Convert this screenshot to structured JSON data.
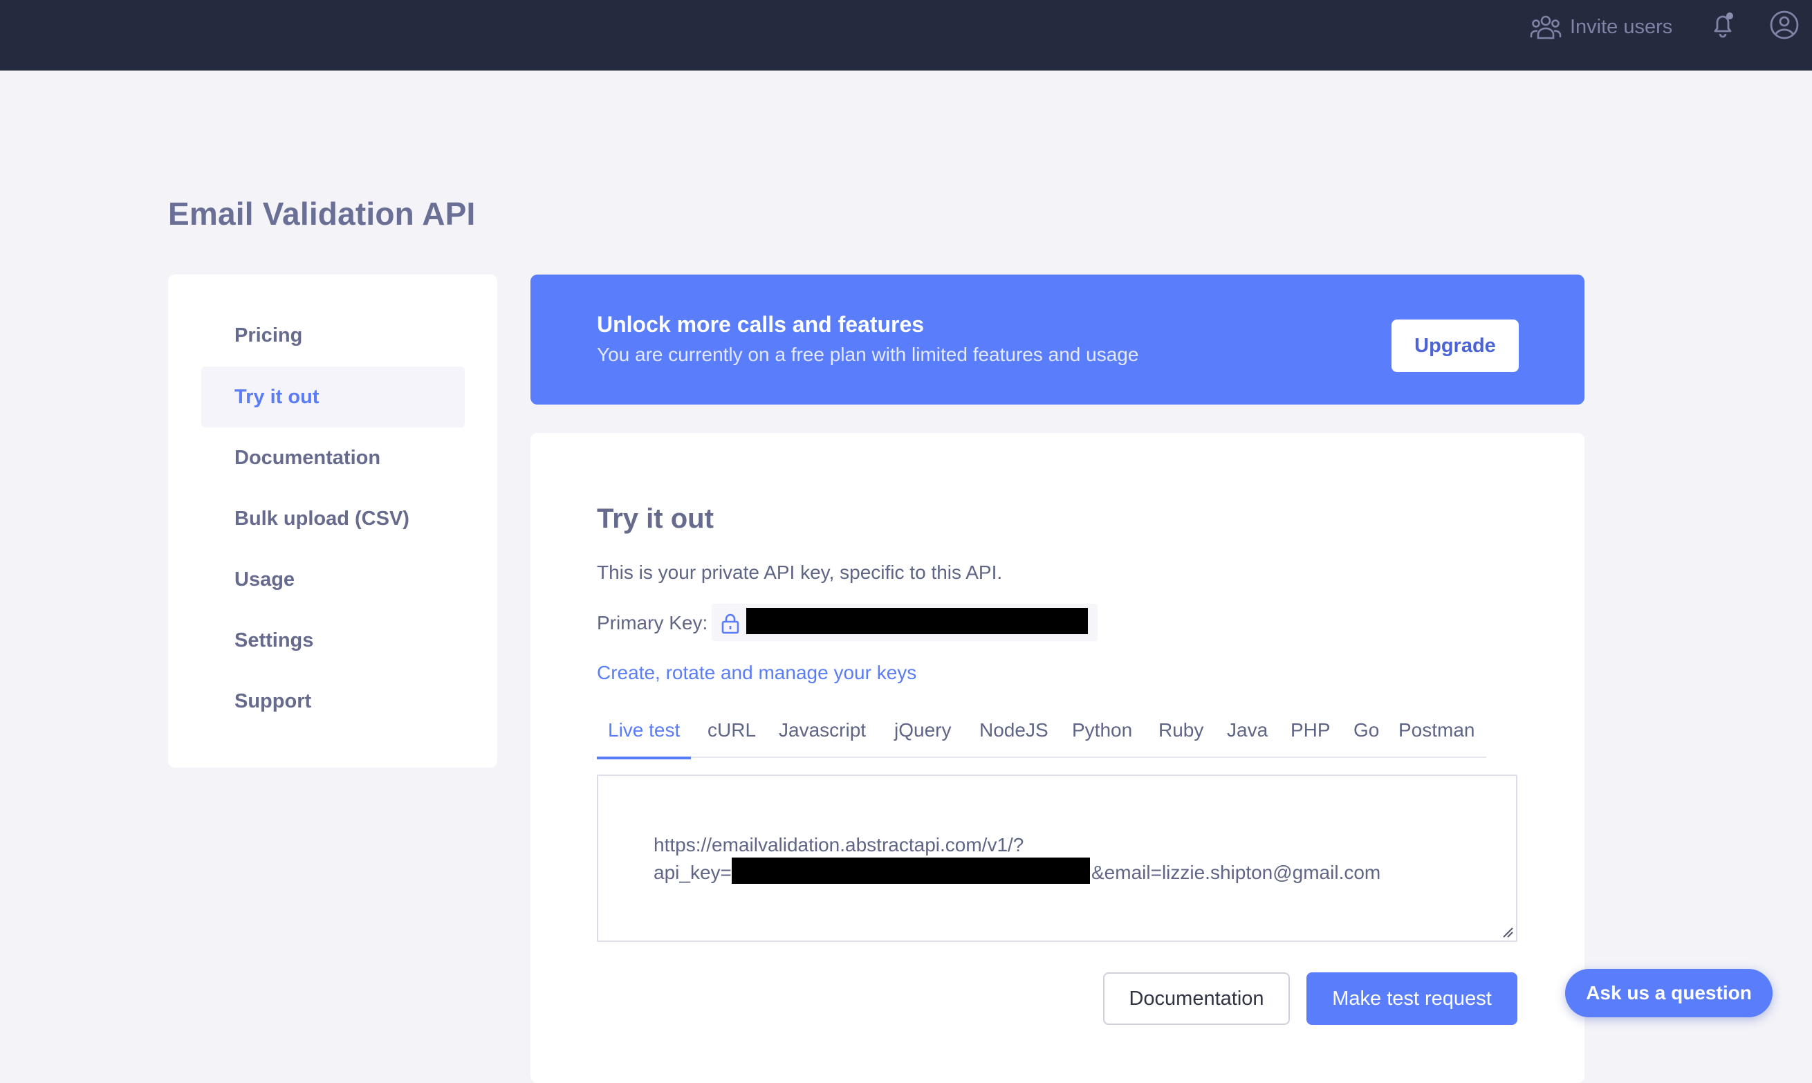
{
  "topbar": {
    "invite_label": "Invite users",
    "icons": [
      "users-icon",
      "bell-icon",
      "user-circle-icon"
    ]
  },
  "page_title": "Email Validation API",
  "sidebar": {
    "items": [
      {
        "label": "Pricing",
        "active": false
      },
      {
        "label": "Try it out",
        "active": true
      },
      {
        "label": "Documentation",
        "active": false
      },
      {
        "label": "Bulk upload (CSV)",
        "active": false
      },
      {
        "label": "Usage",
        "active": false
      },
      {
        "label": "Settings",
        "active": false
      },
      {
        "label": "Support",
        "active": false
      }
    ]
  },
  "banner": {
    "title": "Unlock more calls and features",
    "subtitle": "You are currently on a free plan with limited features and usage",
    "upgrade_label": "Upgrade"
  },
  "card": {
    "title": "Try it out",
    "description": "This is your private API key, specific to this API.",
    "primary_key_label": "Primary Key:",
    "keys_link": "Create, rotate and manage your keys",
    "tabs": [
      "Live test",
      "cURL",
      "Javascript",
      "jQuery",
      "NodeJS",
      "Python",
      "Ruby",
      "Java",
      "PHP",
      "Go",
      "Postman"
    ],
    "active_tab": "Live test",
    "request_url_line1": "https://emailvalidation.abstractapi.com/v1/?",
    "request_url_line2_prefix": "api_key=",
    "request_url_line2_suffix": "&email=lizzie.shipton@gmail.com",
    "documentation_button": "Documentation",
    "test_button": "Make test request"
  },
  "chat": {
    "label": "Ask us a question"
  },
  "colors": {
    "topbar": "#262a3e",
    "accent": "#5a7efb",
    "link": "#5b7cf7",
    "background": "#f3f3f8"
  }
}
